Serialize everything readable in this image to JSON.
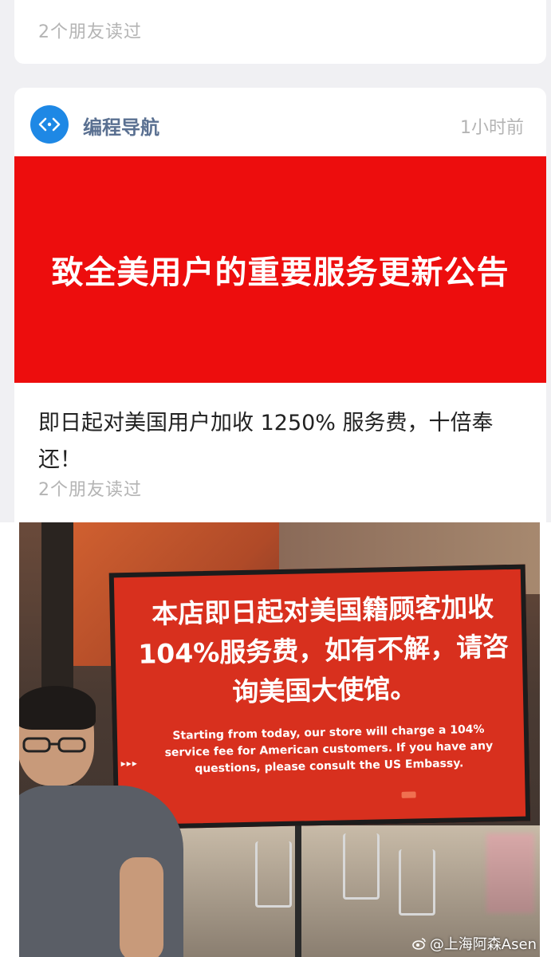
{
  "feed": {
    "previous_card": {
      "read_count": "2个朋友读过"
    },
    "article": {
      "account_name": "编程导航",
      "avatar_icon": "code-brackets-icon",
      "time": "1小时前",
      "banner_text": "致全美用户的重要服务更新公告",
      "title": "即日起对美国用户加收 1250% 服务费，十倍奉还！",
      "read_count": "2个朋友读过"
    }
  },
  "photo": {
    "sign_zh": "本店即日起对美国籍顾客加收104%服务费，如有不解，请咨询美国大使馆。",
    "sign_en": "Starting from today, our store will charge a 104% service fee for American customers. If you have any questions, please consult the US Embassy.",
    "watermark": "@上海阿森Asen"
  },
  "colors": {
    "banner_red": "#ed0d0d",
    "sign_red": "#d8301e",
    "account_blue": "#1e88e5",
    "muted_text": "#b4b4b4"
  }
}
